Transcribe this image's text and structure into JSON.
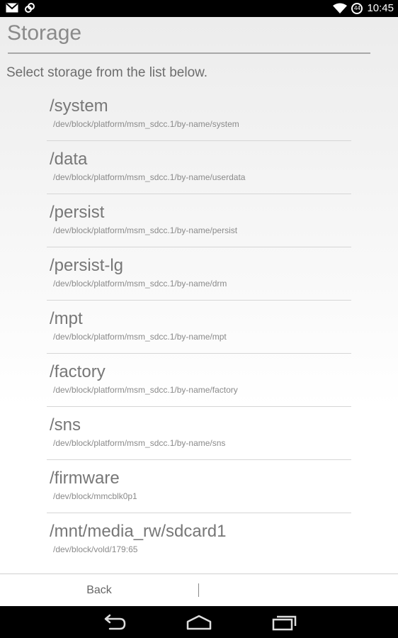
{
  "status_bar": {
    "time": "10:45",
    "battery_level": "44",
    "icons": [
      "gmail-icon",
      "link-icon",
      "wifi-icon",
      "battery-icon"
    ]
  },
  "header": {
    "title": "Storage",
    "subtitle": "Select storage from the list below."
  },
  "storage_list": [
    {
      "name": "/system",
      "path": "/dev/block/platform/msm_sdcc.1/by-name/system"
    },
    {
      "name": "/data",
      "path": "/dev/block/platform/msm_sdcc.1/by-name/userdata"
    },
    {
      "name": "/persist",
      "path": "/dev/block/platform/msm_sdcc.1/by-name/persist"
    },
    {
      "name": "/persist-lg",
      "path": "/dev/block/platform/msm_sdcc.1/by-name/drm"
    },
    {
      "name": "/mpt",
      "path": "/dev/block/platform/msm_sdcc.1/by-name/mpt"
    },
    {
      "name": "/factory",
      "path": "/dev/block/platform/msm_sdcc.1/by-name/factory"
    },
    {
      "name": "/sns",
      "path": "/dev/block/platform/msm_sdcc.1/by-name/sns"
    },
    {
      "name": "/firmware",
      "path": "/dev/block/mmcblk0p1"
    },
    {
      "name": "/mnt/media_rw/sdcard1",
      "path": "/dev/block/vold/179:65"
    }
  ],
  "button_bar": {
    "back_label": "Back"
  },
  "nav_bar": {
    "icons": [
      "back-nav-icon",
      "home-nav-icon",
      "recents-nav-icon"
    ]
  },
  "colors": {
    "status_bar_bg": "#000000",
    "nav_bar_bg": "#000000",
    "text_primary": "#777777",
    "divider": "#d6d6d6"
  }
}
